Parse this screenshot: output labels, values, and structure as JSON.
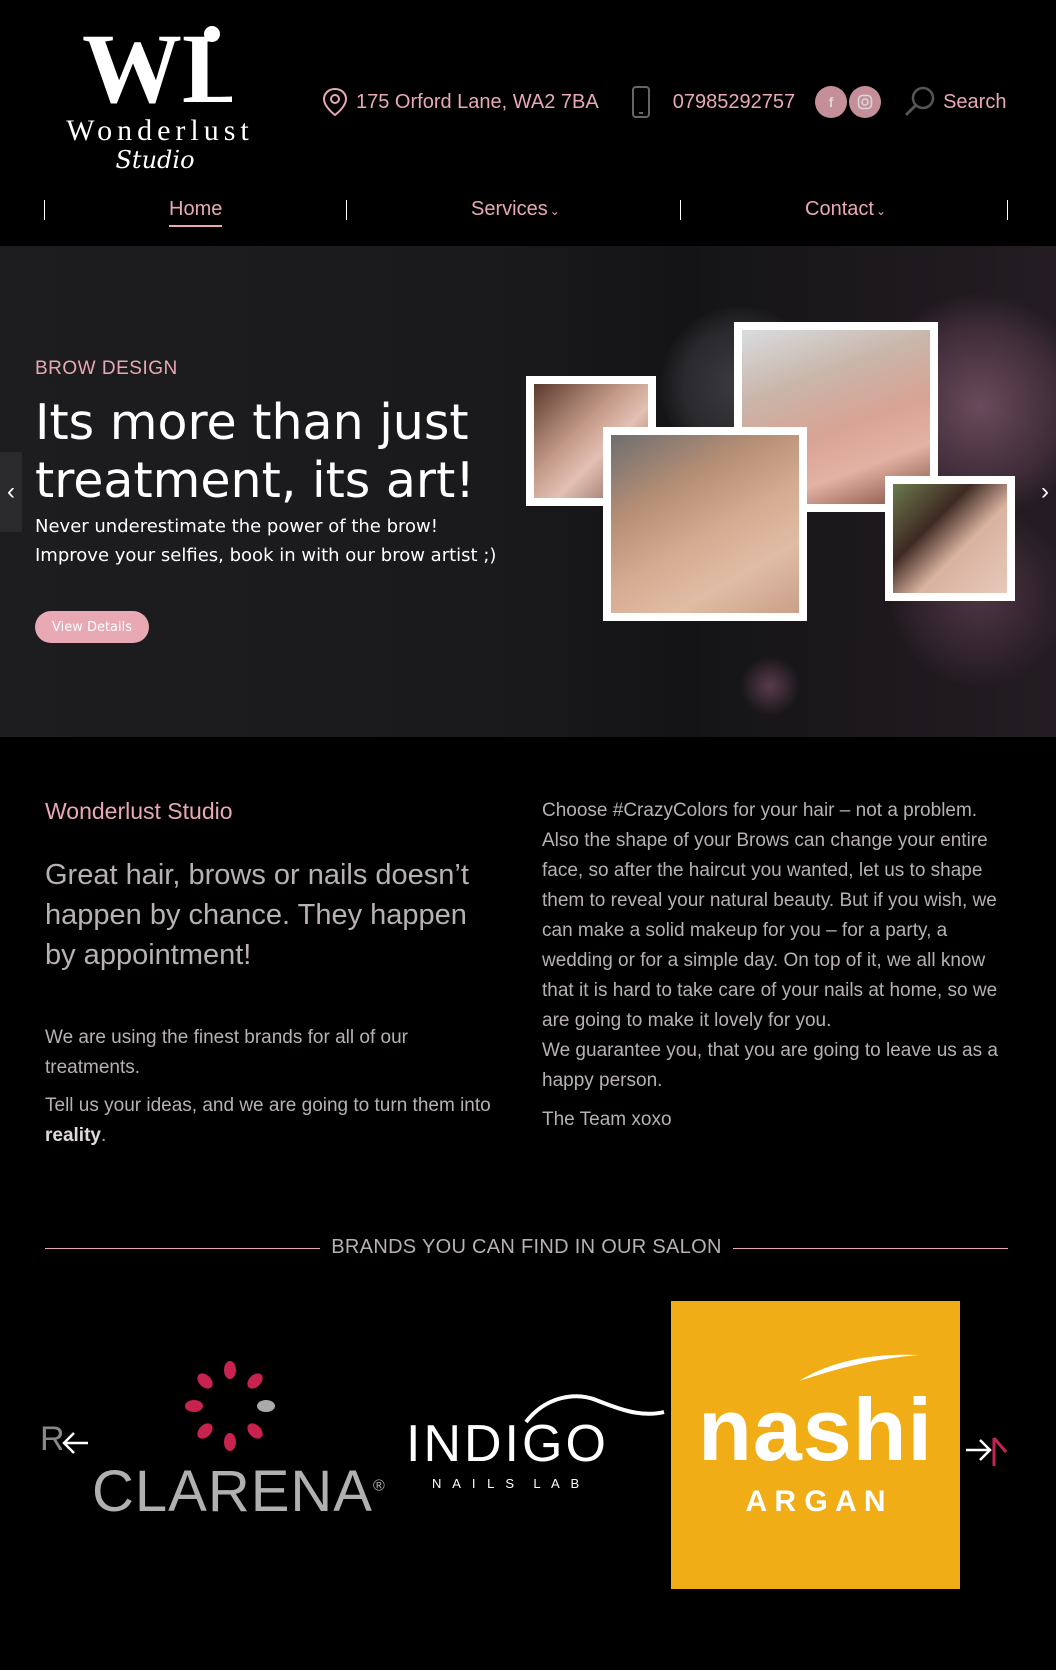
{
  "header": {
    "logo_initials": "WL",
    "logo_name": "Wonderlust",
    "logo_sub": "Studio",
    "address": "175 Orford Lane, WA2 7BA",
    "phone": "07985292757",
    "social": [
      "facebook-icon",
      "instagram-icon"
    ],
    "search_label": "Search"
  },
  "nav": {
    "items": [
      {
        "label": "Home",
        "active": true
      },
      {
        "label": "Services",
        "dropdown": true
      },
      {
        "label": "Contact",
        "dropdown": true
      }
    ]
  },
  "hero": {
    "kicker": "BROW DESIGN",
    "title": "Its more than just treatment, its art!",
    "text": "Never underestimate the power of the brow! Improve your selfies, book in with our brow artist ;)",
    "button": "View Details"
  },
  "about": {
    "kicker": "Wonderlust Studio",
    "lead": "Great hair, brows or nails doesn’t happen by chance. They happen by appointment!",
    "p1": "We are using the finest brands for all of our treatments.",
    "p2_start": "Tell us your ideas, and we are going to turn them into ",
    "p2_bold": "reality",
    "p2_end": ".",
    "right_p1": "Choose #CrazyColors for your hair – not a problem. Also the shape of your Brows can change your entire face, so after the haircut you wanted, let us to shape them to reveal your natural beauty. But if you wish, we can make a solid makeup for you – for a party, a wedding or for a simple day. On top of it, we all know that it is hard to take care of your nails at home, so we are going to make it lovely for you.",
    "right_p2": "We guarantee you, that you are going to leave us as a happy person.",
    "sign": "The Team xoxo"
  },
  "brands": {
    "title": "BRANDS YOU CAN FIND IN OUR SALON",
    "partial_left": "RE",
    "clarena": "CLARENA",
    "clarena_reg": "®",
    "indigo_top": "INDIGO",
    "indigo_sub": "N A I L S  L A B",
    "nashi_top": "nashi",
    "nashi_sub": "A R G A N",
    "colors": {
      "accent": "#e8a9b4",
      "nashi_bg": "#f0ad16",
      "clarena_petal": "#c8224e"
    }
  }
}
